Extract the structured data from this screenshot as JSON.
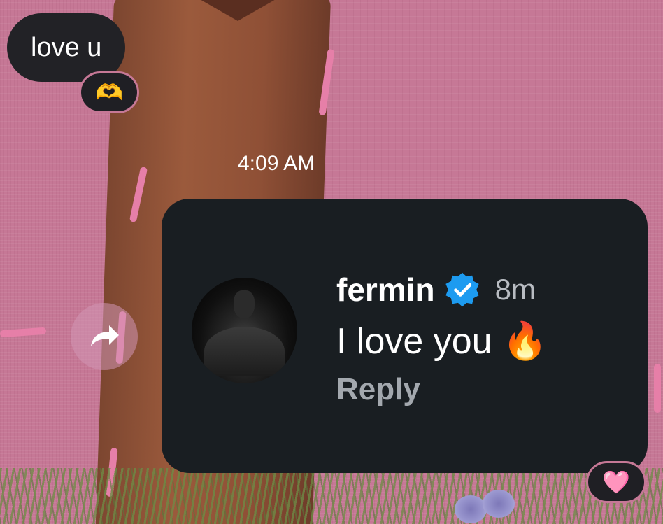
{
  "messages": {
    "incoming_text": "love u",
    "incoming_reaction": "🫶",
    "timestamp": "4:09 AM"
  },
  "shared_comment": {
    "username": "fermin",
    "verified": true,
    "age": "8m",
    "text": "I love you 🔥",
    "reply_label": "Reply",
    "reaction": "🩷"
  },
  "icons": {
    "forward": "forward-share-icon",
    "verified": "verified-badge-icon"
  },
  "colors": {
    "background": "#c67896",
    "bubble": "#222226",
    "card": "#191e22",
    "verified_blue": "#1d9bf0"
  }
}
